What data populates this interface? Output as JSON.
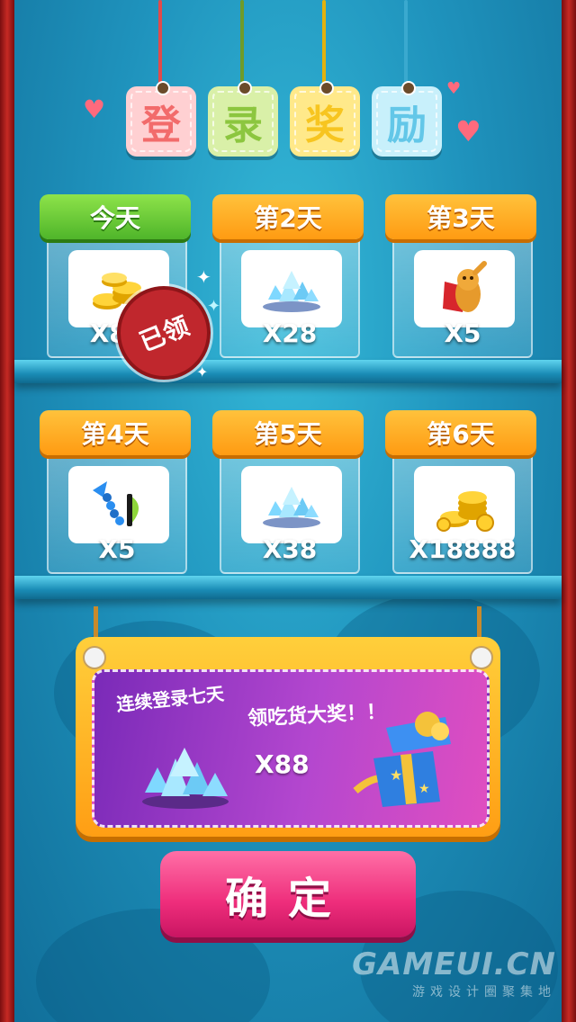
{
  "title": {
    "chars": [
      "登",
      "录",
      "奖",
      "励"
    ],
    "colors": [
      "#f26b6b",
      "#8cc63f",
      "#f7c520",
      "#63c7e8"
    ],
    "tag_bgs": [
      "#ffd0d2",
      "#d9f0a8",
      "#ffe98a",
      "#c8f0fb"
    ]
  },
  "rewards": [
    {
      "day_label": "今天",
      "item_icon": "gold-coins-icon",
      "quantity": "X88",
      "claimed": true
    },
    {
      "day_label": "第2天",
      "item_icon": "diamonds-icon",
      "quantity": "X28",
      "claimed": false
    },
    {
      "day_label": "第3天",
      "item_icon": "caped-hero-icon",
      "quantity": "X5",
      "claimed": false
    },
    {
      "day_label": "第4天",
      "item_icon": "magnet-tool-icon",
      "quantity": "X5",
      "claimed": false
    },
    {
      "day_label": "第5天",
      "item_icon": "diamonds-icon",
      "quantity": "X38",
      "claimed": false
    },
    {
      "day_label": "第6天",
      "item_icon": "gold-coins-icon",
      "quantity": "X18888",
      "claimed": false
    }
  ],
  "claimed_stamp": "已领",
  "grand_prize": {
    "line1": "连续登录七天",
    "line2": "领吃货大奖！！",
    "item_icon": "diamonds-icon",
    "quantity": "X88",
    "gift_icon": "gift-box-icon"
  },
  "confirm_button": "确定",
  "watermark": {
    "brand": "GAMEUI.CN",
    "subtitle": "游戏设计圈聚集地"
  },
  "colors": {
    "background": "#1f93bd",
    "banner_orange": "#ff9b12",
    "banner_today": "#4fb52a",
    "confirm_pink": "#ee2d7b",
    "stamp_red": "#c0272d"
  }
}
